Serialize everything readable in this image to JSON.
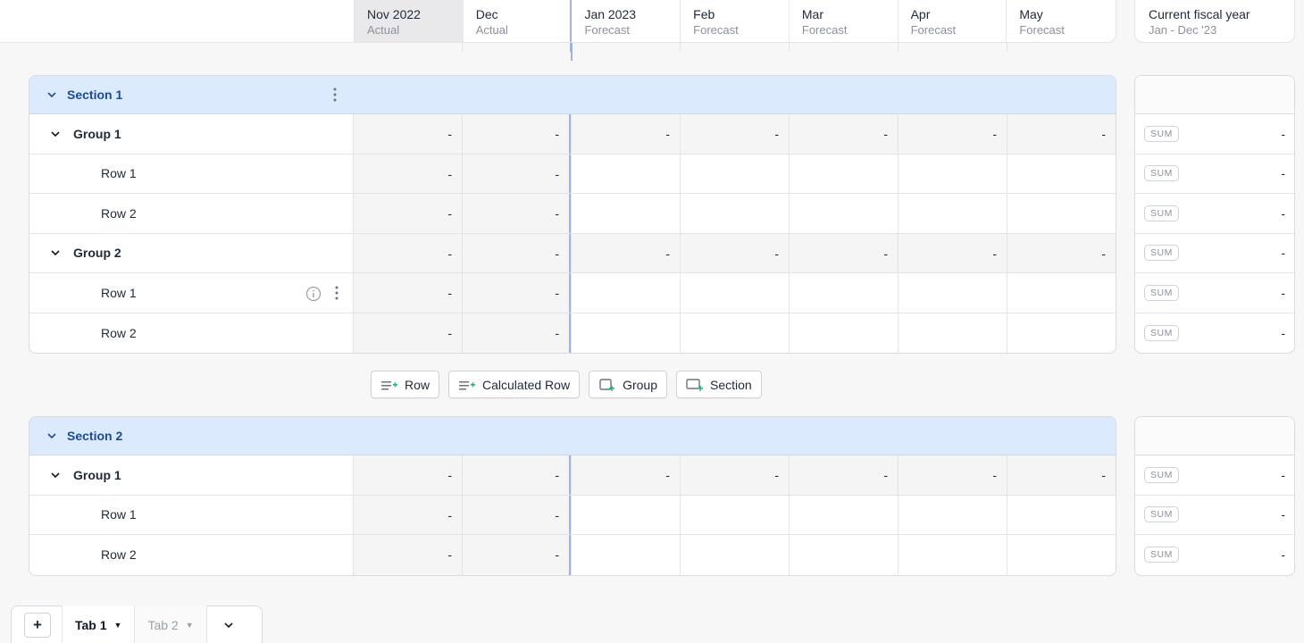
{
  "columns": [
    {
      "title": "Nov 2022",
      "sub": "Actual"
    },
    {
      "title": "Dec",
      "sub": "Actual"
    },
    {
      "title": "Jan 2023",
      "sub": "Forecast"
    },
    {
      "title": "Feb",
      "sub": "Forecast"
    },
    {
      "title": "Mar",
      "sub": "Forecast"
    },
    {
      "title": "Apr",
      "sub": "Forecast"
    },
    {
      "title": "May",
      "sub": "Forecast"
    }
  ],
  "fiscal": {
    "title": "Current fiscal year",
    "sub": "Jan - Dec '23"
  },
  "sections": [
    {
      "title": "Section 1",
      "rows": [
        {
          "label": "Group 1",
          "values": [
            "-",
            "-",
            "-",
            "-",
            "-",
            "-",
            "-"
          ],
          "total": "-",
          "badge": "SUM"
        },
        {
          "label": "Row 1",
          "values": [
            "-",
            "-",
            "",
            "",
            "",
            "",
            ""
          ],
          "total": "-",
          "badge": "SUM"
        },
        {
          "label": "Row 2",
          "values": [
            "-",
            "-",
            "",
            "",
            "",
            "",
            ""
          ],
          "total": "-",
          "badge": "SUM"
        },
        {
          "label": "Group 2",
          "values": [
            "-",
            "-",
            "-",
            "-",
            "-",
            "-",
            "-"
          ],
          "total": "-",
          "badge": "SUM"
        },
        {
          "label": "Row 1",
          "values": [
            "-",
            "-",
            "",
            "",
            "",
            "",
            ""
          ],
          "total": "-",
          "badge": "SUM"
        },
        {
          "label": "Row 2",
          "values": [
            "-",
            "-",
            "",
            "",
            "",
            "",
            ""
          ],
          "total": "-",
          "badge": "SUM"
        }
      ]
    },
    {
      "title": "Section 2",
      "rows": [
        {
          "label": "Group 1",
          "values": [
            "-",
            "-",
            "-",
            "-",
            "-",
            "-",
            "-"
          ],
          "total": "-",
          "badge": "SUM"
        },
        {
          "label": "Row 1",
          "values": [
            "-",
            "-",
            "",
            "",
            "",
            "",
            ""
          ],
          "total": "-",
          "badge": "SUM"
        },
        {
          "label": "Row 2",
          "values": [
            "-",
            "-",
            "",
            "",
            "",
            "",
            ""
          ],
          "total": "-",
          "badge": "SUM"
        }
      ]
    }
  ],
  "add_buttons": {
    "row": "Row",
    "calculated_row": "Calculated Row",
    "group": "Group",
    "section": "Section"
  },
  "tabs": {
    "add": "+",
    "tab1": "Tab 1",
    "tab2": "Tab 2"
  },
  "colors": {
    "accent": "#1e4b8f",
    "section_bg": "#dceafd",
    "divider": "#a3b3df",
    "add_icon_green": "#2bb673"
  }
}
